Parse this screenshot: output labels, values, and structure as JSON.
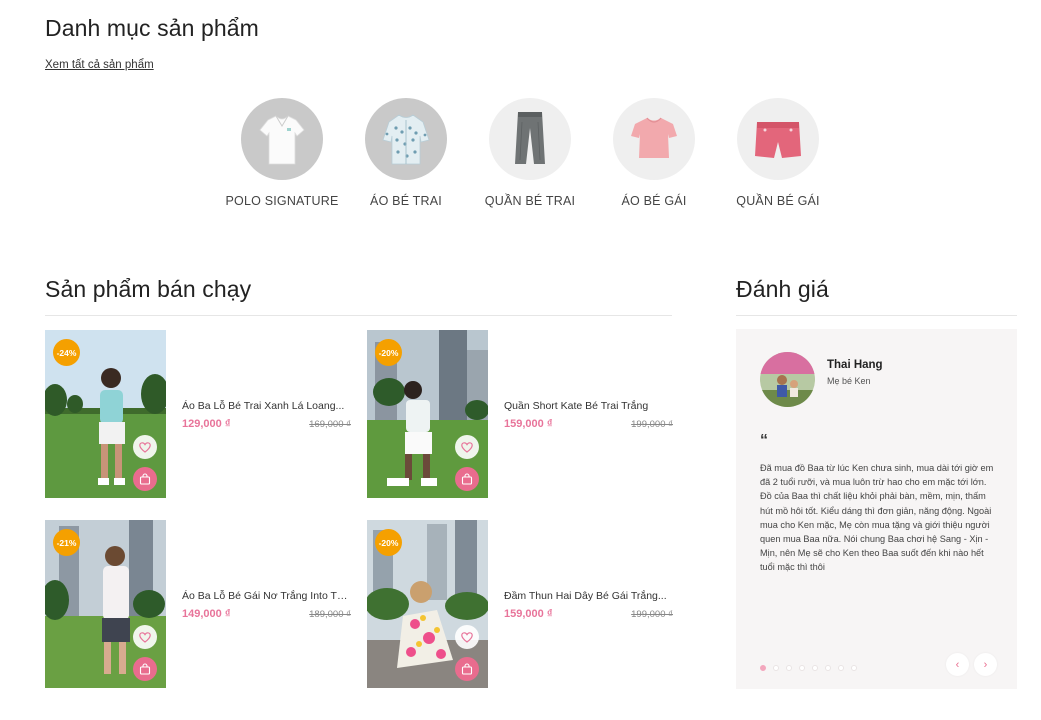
{
  "categories_section": {
    "title": "Danh mục sản phẩm",
    "view_all": "Xem tất cả sản phẩm",
    "items": [
      {
        "label": "POLO SIGNATURE",
        "icon": "polo-shirt-icon"
      },
      {
        "label": "ÁO BÉ TRAI",
        "icon": "boys-shirt-icon"
      },
      {
        "label": "QUẦN BÉ TRAI",
        "icon": "boys-pants-icon"
      },
      {
        "label": "ÁO BÉ GÁI",
        "icon": "girls-top-icon"
      },
      {
        "label": "QUẦN BÉ GÁI",
        "icon": "girls-shorts-icon"
      }
    ]
  },
  "bestsellers": {
    "title": "Sản phẩm bán chạy",
    "products": [
      {
        "badge": "-24%",
        "name": "Áo Ba Lỗ Bé Trai Xanh Lá Loang...",
        "price": "129,000 ₫",
        "old_price": "169,000 ₫"
      },
      {
        "badge": "-20%",
        "name": "Quần Short Kate Bé Trai Trắng",
        "price": "159,000 ₫",
        "old_price": "199,000 ₫"
      },
      {
        "badge": "-21%",
        "name": "Áo Ba Lỗ Bé Gái Nơ Trắng Into The...",
        "price": "149,000 ₫",
        "old_price": "189,000 ₫"
      },
      {
        "badge": "-20%",
        "name": "Đầm Thun Hai Dây Bé Gái Trắng...",
        "price": "159,000 ₫",
        "old_price": "199,000 ₫"
      }
    ]
  },
  "reviews": {
    "title": "Đánh giá",
    "quote_mark": "“",
    "current": {
      "name": "Thai Hang",
      "role": "Mẹ bé Ken",
      "text": "Đã mua đồ Baa từ lúc Ken chưa sinh, mua dài tới giờ em đã 2 tuổi rưỡi, và mua luôn trừ hao cho em mặc tới lớn. Đồ của Baa thì chất liệu khỏi phải bàn, mềm, mịn, thấm hút mồ hôi tốt. Kiểu dáng thì đơn giản, năng động. Ngoài mua cho Ken mặc, Mẹ còn mua tặng và giới thiệu người quen mua Baa nữa. Nói chung Baa chơi hệ Sang - Xịn - Mịn, nên Mẹ sẽ cho Ken theo Baa suốt đến khi nào hết tuổi mặc thì thôi"
    },
    "slide_count": 8,
    "active_slide": 1,
    "prev_icon": "chevron-left-icon",
    "next_icon": "chevron-right-icon"
  },
  "colors": {
    "accent_pink": "#e8749a",
    "badge_orange": "#f5a000",
    "review_bg": "#f7f5f5"
  }
}
